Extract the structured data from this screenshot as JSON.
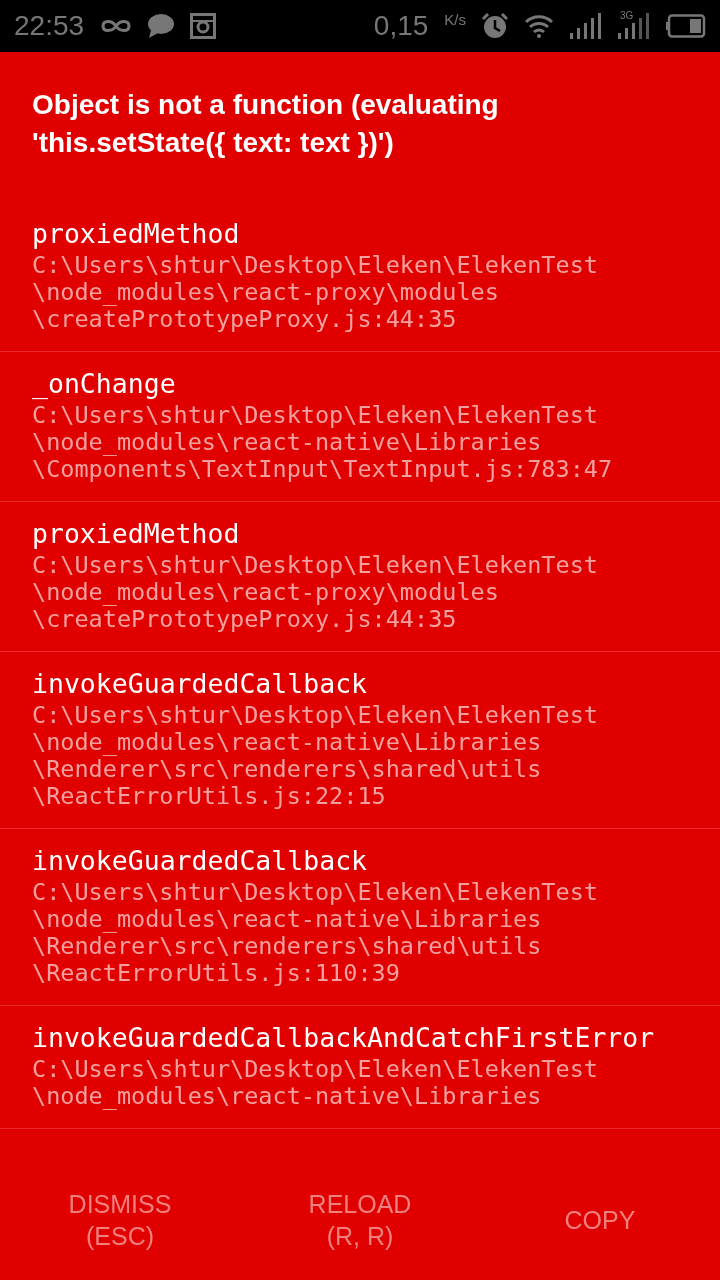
{
  "status_bar": {
    "time": "22:53",
    "speed": "0,15",
    "speed_unit": "K/s",
    "network": "3G"
  },
  "error": {
    "message": "Object is not a function (evaluating 'this.setState({ text: text })')"
  },
  "stack": [
    {
      "method": "proxiedMethod",
      "path": [
        "C:\\Users\\shtur\\Desktop\\Eleken\\ElekenTest",
        "\\node_modules\\react-proxy\\modules",
        "\\createPrototypeProxy.js:44:35"
      ]
    },
    {
      "method": "_onChange",
      "path": [
        "C:\\Users\\shtur\\Desktop\\Eleken\\ElekenTest",
        "\\node_modules\\react-native\\Libraries",
        "\\Components\\TextInput\\TextInput.js:783:47"
      ]
    },
    {
      "method": "proxiedMethod",
      "path": [
        "C:\\Users\\shtur\\Desktop\\Eleken\\ElekenTest",
        "\\node_modules\\react-proxy\\modules",
        "\\createPrototypeProxy.js:44:35"
      ]
    },
    {
      "method": "invokeGuardedCallback",
      "path": [
        "C:\\Users\\shtur\\Desktop\\Eleken\\ElekenTest",
        "\\node_modules\\react-native\\Libraries",
        "\\Renderer\\src\\renderers\\shared\\utils",
        "\\ReactErrorUtils.js:22:15"
      ]
    },
    {
      "method": "invokeGuardedCallback",
      "path": [
        "C:\\Users\\shtur\\Desktop\\Eleken\\ElekenTest",
        "\\node_modules\\react-native\\Libraries",
        "\\Renderer\\src\\renderers\\shared\\utils",
        "\\ReactErrorUtils.js:110:39"
      ]
    },
    {
      "method": "invokeGuardedCallbackAndCatchFirstError",
      "path": [
        "C:\\Users\\shtur\\Desktop\\Eleken\\ElekenTest",
        "\\node_modules\\react-native\\Libraries"
      ]
    }
  ],
  "buttons": [
    {
      "label": "DISMISS\n(ESC)"
    },
    {
      "label": "RELOAD\n(R, R)"
    },
    {
      "label": "COPY"
    }
  ]
}
